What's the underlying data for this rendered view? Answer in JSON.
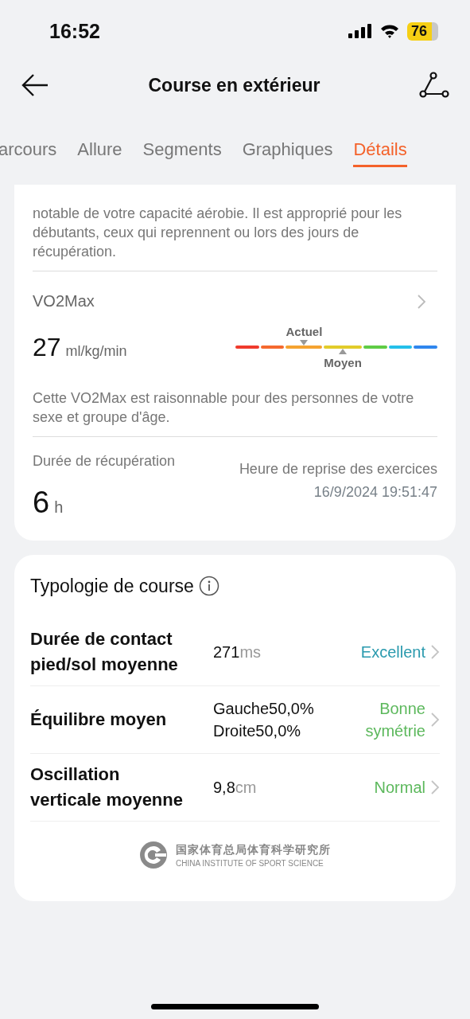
{
  "status_bar": {
    "time": "16:52",
    "battery": "76"
  },
  "header": {
    "title": "Course en extérieur"
  },
  "tabs": [
    {
      "label": "arcours",
      "selected": false
    },
    {
      "label": "Allure",
      "selected": false
    },
    {
      "label": "Segments",
      "selected": false
    },
    {
      "label": "Graphiques",
      "selected": false
    },
    {
      "label": "Détails",
      "selected": true
    }
  ],
  "intro_text": "notable de votre capacité aérobie. Il est approprié pour les débutants, ceux qui reprennent ou lors des jours de récupération.",
  "vo2max": {
    "title": "VO2Max",
    "value": "27",
    "unit": "ml/kg/min",
    "scale": {
      "segments": [
        {
          "color": "#f03a2c",
          "current": false,
          "average": false
        },
        {
          "color": "#f5692e",
          "current": false,
          "average": false
        },
        {
          "color": "#f5a330",
          "current": true,
          "average": false
        },
        {
          "color": "#e2cc2a",
          "current": false,
          "average": true
        },
        {
          "color": "#5fcc45",
          "current": false,
          "average": false
        },
        {
          "color": "#25c0ea",
          "current": false,
          "average": false
        },
        {
          "color": "#2f86ee",
          "current": false,
          "average": false
        }
      ],
      "current_label": "Actuel",
      "average_label": "Moyen"
    },
    "description": "Cette VO2Max est raisonnable pour des personnes de votre sexe et groupe d'âge."
  },
  "recovery": {
    "label": "Durée de récupération",
    "value": "6",
    "unit": "h",
    "resume_label": "Heure de reprise des exercices",
    "resume_time": "16/9/2024 19:51:47"
  },
  "typology": {
    "title": "Typologie de course",
    "rows": [
      {
        "kind": "single",
        "label": "Durée de contact pied/sol moyenne",
        "value": "271",
        "unit": "ms",
        "rating": "Excellent",
        "color": "#2a9aae"
      },
      {
        "kind": "double",
        "label": "Équilibre moyen",
        "lines": [
          "Gauche50,0%",
          "Droite50,0%"
        ],
        "rating": "Bonne symétrie",
        "color": "#5cb85c"
      },
      {
        "kind": "single",
        "label": "Oscillation verticale moyenne",
        "value": "9,8",
        "unit": "cm",
        "rating": "Normal",
        "color": "#5cb85c"
      }
    ],
    "footer": {
      "name_cn": "国家体育总局体育科学研究所",
      "name_en": "CHINA INSTITUTE OF SPORT SCIENCE"
    }
  }
}
